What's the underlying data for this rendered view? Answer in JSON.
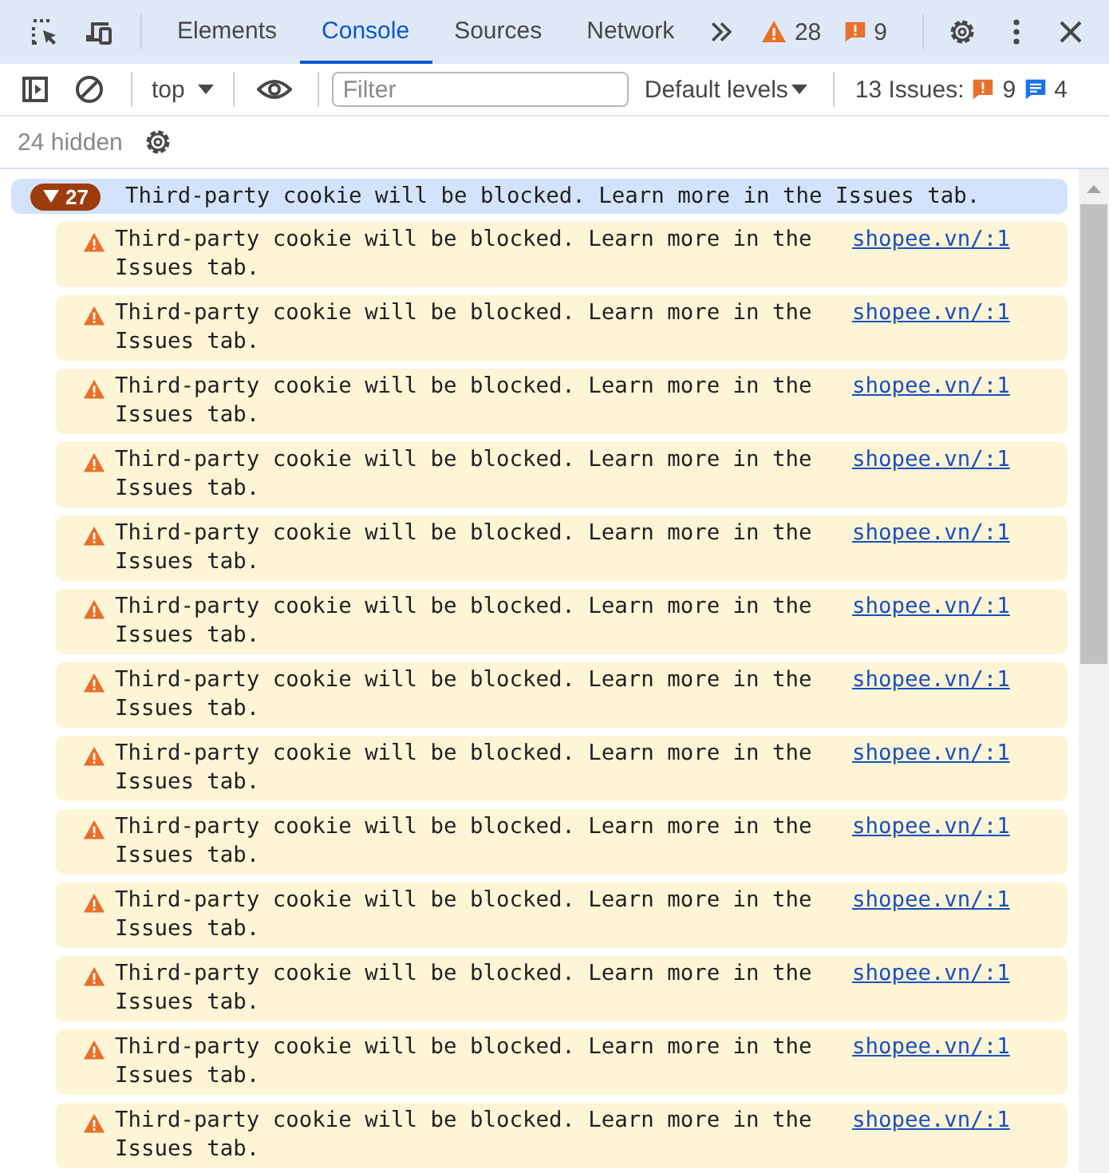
{
  "tabs": [
    {
      "label": "Elements",
      "selected": false
    },
    {
      "label": "Console",
      "selected": true
    },
    {
      "label": "Sources",
      "selected": false
    },
    {
      "label": "Network",
      "selected": false
    }
  ],
  "counters": {
    "warnings": "28",
    "errors": "9"
  },
  "toolbar": {
    "context": "top",
    "filter_placeholder": "Filter",
    "levels": "Default levels",
    "issues_label": "13 Issues:",
    "issue_errors": "9",
    "issue_info": "4"
  },
  "hidden": "24 hidden",
  "group": {
    "count": "27",
    "expanded": true,
    "message": "Third-party cookie will be blocked. Learn more in the Issues tab."
  },
  "messages": [
    {
      "kind": "warning",
      "text": "Third-party cookie will be blocked. Learn more in the Issues tab.",
      "source": "shopee.vn/:1"
    },
    {
      "kind": "warning",
      "text": "Third-party cookie will be blocked. Learn more in the Issues tab.",
      "source": "shopee.vn/:1"
    },
    {
      "kind": "warning",
      "text": "Third-party cookie will be blocked. Learn more in the Issues tab.",
      "source": "shopee.vn/:1"
    },
    {
      "kind": "warning",
      "text": "Third-party cookie will be blocked. Learn more in the Issues tab.",
      "source": "shopee.vn/:1"
    },
    {
      "kind": "warning",
      "text": "Third-party cookie will be blocked. Learn more in the Issues tab.",
      "source": "shopee.vn/:1"
    },
    {
      "kind": "warning",
      "text": "Third-party cookie will be blocked. Learn more in the Issues tab.",
      "source": "shopee.vn/:1"
    },
    {
      "kind": "warning",
      "text": "Third-party cookie will be blocked. Learn more in the Issues tab.",
      "source": "shopee.vn/:1"
    },
    {
      "kind": "warning",
      "text": "Third-party cookie will be blocked. Learn more in the Issues tab.",
      "source": "shopee.vn/:1"
    },
    {
      "kind": "warning",
      "text": "Third-party cookie will be blocked. Learn more in the Issues tab.",
      "source": "shopee.vn/:1"
    },
    {
      "kind": "warning",
      "text": "Third-party cookie will be blocked. Learn more in the Issues tab.",
      "source": "shopee.vn/:1"
    },
    {
      "kind": "warning",
      "text": "Third-party cookie will be blocked. Learn more in the Issues tab.",
      "source": "shopee.vn/:1"
    },
    {
      "kind": "warning",
      "text": "Third-party cookie will be blocked. Learn more in the Issues tab.",
      "source": "shopee.vn/:1"
    },
    {
      "kind": "warning",
      "text": "Third-party cookie will be blocked. Learn more in the Issues tab.",
      "source": "shopee.vn/:1"
    }
  ]
}
